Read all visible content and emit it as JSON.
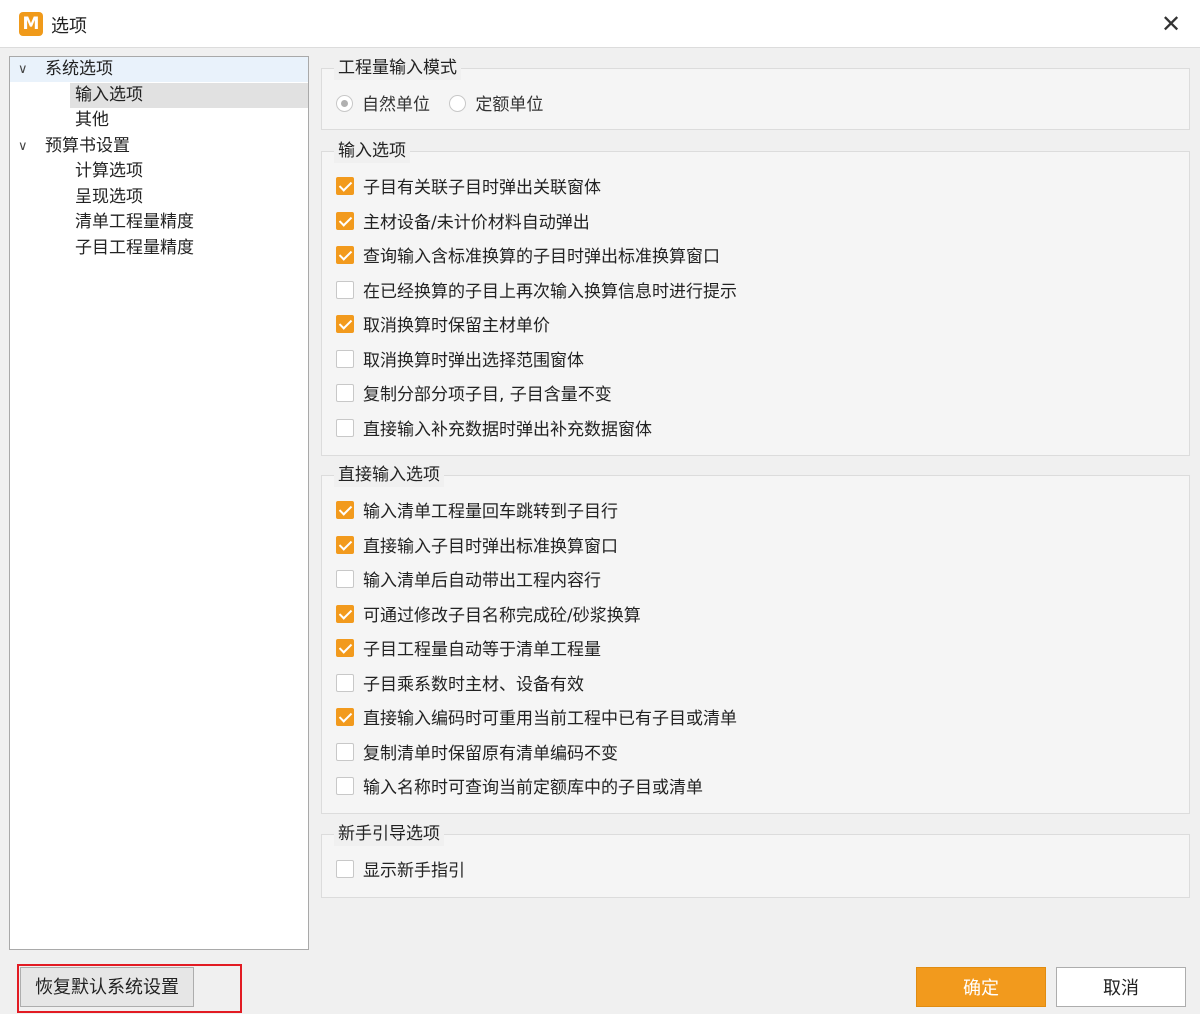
{
  "window": {
    "logo": "M",
    "title": "选项",
    "close_glyph": "✕"
  },
  "tree": {
    "nodes": [
      {
        "label": "系统选项",
        "expanded": true
      },
      {
        "label": "输入选项",
        "selected": true
      },
      {
        "label": "其他"
      },
      {
        "label": "预算书设置",
        "expanded": true
      },
      {
        "label": "计算选项"
      },
      {
        "label": "呈现选项"
      },
      {
        "label": "清单工程量精度"
      },
      {
        "label": "子目工程量精度"
      }
    ]
  },
  "mode_group": {
    "title": "工程量输入模式",
    "options": [
      {
        "label": "自然单位",
        "selected": true
      },
      {
        "label": "定额单位",
        "selected": false
      }
    ]
  },
  "input_group": {
    "title": "输入选项",
    "options": [
      {
        "label": "子目有关联子目时弹出关联窗体",
        "checked": true
      },
      {
        "label": "主材设备/未计价材料自动弹出",
        "checked": true
      },
      {
        "label": "查询输入含标准换算的子目时弹出标准换算窗口",
        "checked": true
      },
      {
        "label": "在已经换算的子目上再次输入换算信息时进行提示",
        "checked": false
      },
      {
        "label": "取消换算时保留主材单价",
        "checked": true
      },
      {
        "label": "取消换算时弹出选择范围窗体",
        "checked": false
      },
      {
        "label": "复制分部分项子目, 子目含量不变",
        "checked": false
      },
      {
        "label": "直接输入补充数据时弹出补充数据窗体",
        "checked": false
      }
    ]
  },
  "direct_group": {
    "title": "直接输入选项",
    "options": [
      {
        "label": "输入清单工程量回车跳转到子目行",
        "checked": true
      },
      {
        "label": "直接输入子目时弹出标准换算窗口",
        "checked": true
      },
      {
        "label": "输入清单后自动带出工程内容行",
        "checked": false
      },
      {
        "label": "可通过修改子目名称完成砼/砂浆换算",
        "checked": true
      },
      {
        "label": "子目工程量自动等于清单工程量",
        "checked": true
      },
      {
        "label": "子目乘系数时主材、设备有效",
        "checked": false
      },
      {
        "label": "直接输入编码时可重用当前工程中已有子目或清单",
        "checked": true
      },
      {
        "label": "复制清单时保留原有清单编码不变",
        "checked": false
      },
      {
        "label": "输入名称时可查询当前定额库中的子目或清单",
        "checked": false
      }
    ]
  },
  "guide_group": {
    "title": "新手引导选项",
    "options": [
      {
        "label": "显示新手指引",
        "checked": false
      }
    ]
  },
  "footer": {
    "restore_label": "恢复默认系统设置",
    "ok_label": "确定",
    "cancel_label": "取消"
  },
  "colors": {
    "accent": "#f29a1d",
    "highlight": "#e21b23"
  }
}
